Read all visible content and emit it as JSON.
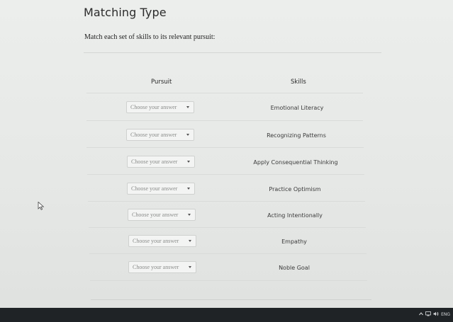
{
  "page": {
    "title": "Matching Type",
    "instructions": "Match each set of skills to its relevant pursuit:"
  },
  "table": {
    "headers": {
      "pursuit": "Pursuit",
      "skills": "Skills"
    },
    "rows": [
      {
        "dropdown": "Choose your answer",
        "skill": "Emotional Literacy"
      },
      {
        "dropdown": "Choose your answer",
        "skill": "Recognizing Patterns"
      },
      {
        "dropdown": "Choose your answer",
        "skill": "Apply Consequential Thinking"
      },
      {
        "dropdown": "Choose your answer",
        "skill": "Practice Optimism"
      },
      {
        "dropdown": "Choose your answer",
        "skill": "Acting Intentionally"
      },
      {
        "dropdown": "Choose your answer",
        "skill": "Empathy"
      },
      {
        "dropdown": "Choose your answer",
        "skill": "Noble Goal"
      }
    ]
  },
  "taskbar": {
    "tray_icons": [
      "chevron-up-icon",
      "network-icon",
      "volume-icon"
    ],
    "language": "ENG"
  }
}
